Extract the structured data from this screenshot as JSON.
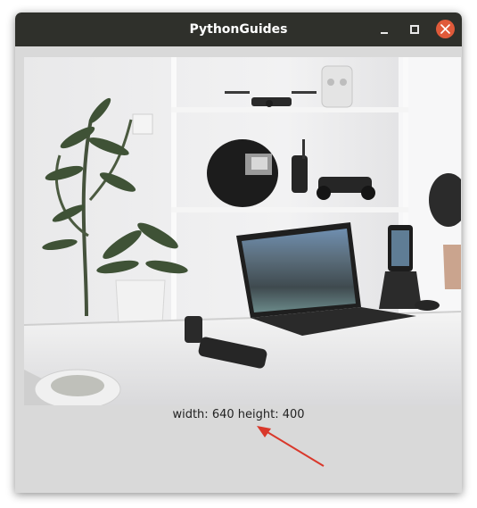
{
  "window": {
    "title": "PythonGuides",
    "controls": [
      "minimize-icon",
      "maximize-icon",
      "close-icon"
    ],
    "colors": {
      "titlebar": "#2f302b",
      "close": "#e05a3a",
      "client": "#d9d9d9"
    }
  },
  "content": {
    "caption": "width: 640 height: 400"
  },
  "annotation": {
    "arrow_color": "#d9382b"
  }
}
